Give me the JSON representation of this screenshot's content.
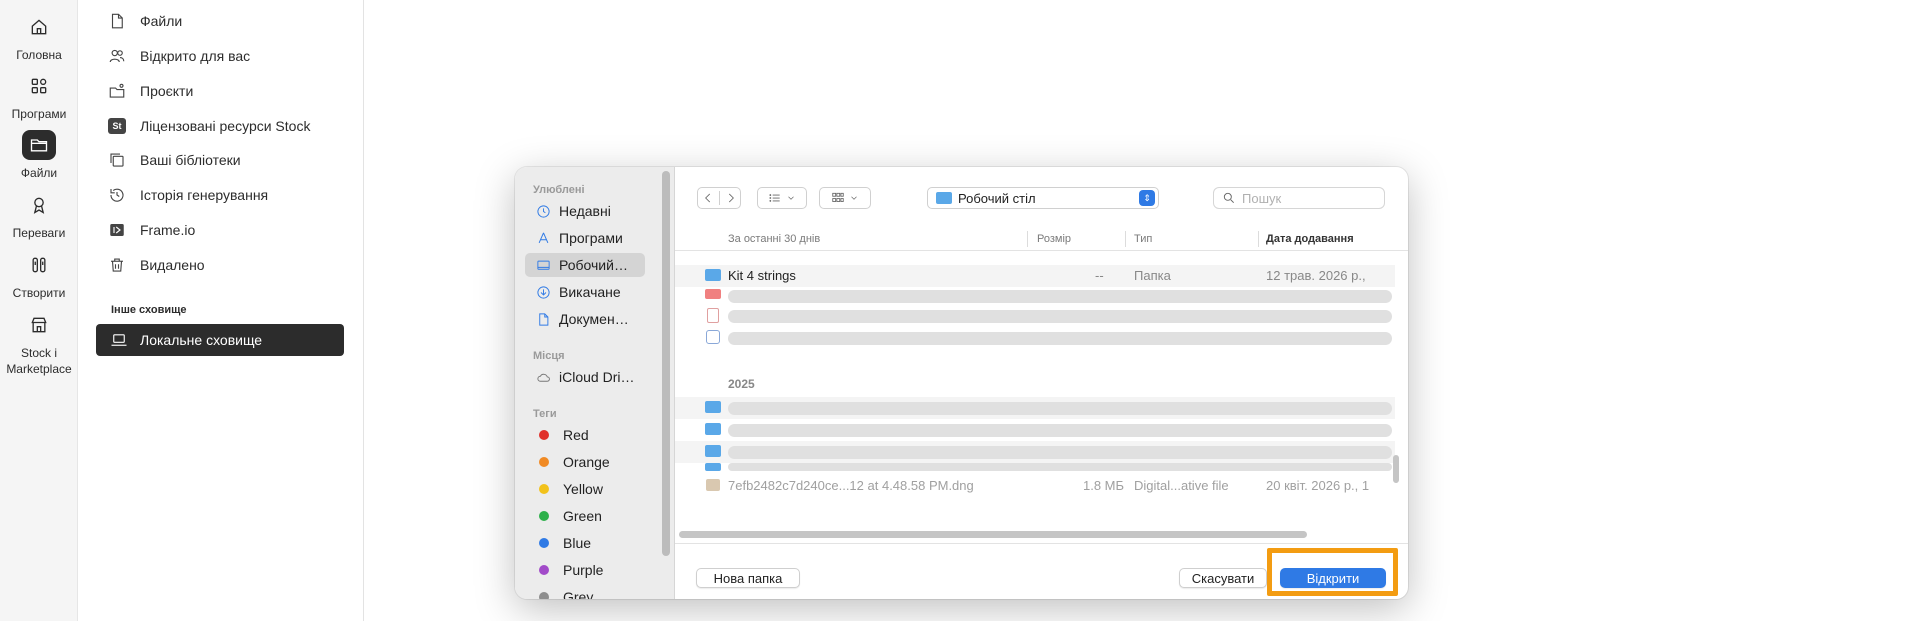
{
  "rail": [
    {
      "label": "Головна",
      "icon": "home-icon"
    },
    {
      "label": "Програми",
      "icon": "apps-icon"
    },
    {
      "label": "Файли",
      "icon": "folder-icon",
      "active": true
    },
    {
      "label": "Переваги",
      "icon": "award-icon"
    },
    {
      "label": "Створити",
      "icon": "create-icon"
    },
    {
      "label_line1": "Stock і",
      "label_line2": "Marketplace",
      "icon": "store-icon"
    }
  ],
  "sidebar": {
    "items": [
      {
        "label": "Файли",
        "icon": "file-icon"
      },
      {
        "label": "Відкрито для вас",
        "icon": "shared-icon"
      },
      {
        "label": "Проєкти",
        "icon": "projects-icon"
      },
      {
        "label": "Ліцензовані ресурси Stock",
        "icon": "stock-icon",
        "badge": "St"
      },
      {
        "label": "Ваші бібліотеки",
        "icon": "libraries-icon"
      },
      {
        "label": "Історія генерування",
        "icon": "history-icon"
      },
      {
        "label": "Frame.io",
        "icon": "frameio-icon"
      },
      {
        "label": "Видалено",
        "icon": "trash-icon"
      }
    ],
    "other_storage_heading": "Інше сховище",
    "local_storage": "Локальне сховище"
  },
  "dialog": {
    "sidebar": {
      "favorites_heading": "Улюблені",
      "favorites": [
        {
          "label": "Недавні",
          "icon": "clock-icon"
        },
        {
          "label": "Програми",
          "icon": "apps-icon"
        },
        {
          "label": "Робочий…",
          "icon": "desktop-icon",
          "selected": true
        },
        {
          "label": "Викачане",
          "icon": "download-icon"
        },
        {
          "label": "Докумен…",
          "icon": "document-icon"
        }
      ],
      "locations_heading": "Місця",
      "locations": [
        {
          "label": "iCloud Dri…",
          "icon": "cloud-icon"
        }
      ],
      "tags_heading": "Теги",
      "tags": [
        {
          "label": "Red",
          "color": "#e0302a"
        },
        {
          "label": "Orange",
          "color": "#f08a24"
        },
        {
          "label": "Yellow",
          "color": "#f2c21b"
        },
        {
          "label": "Green",
          "color": "#2db04a"
        },
        {
          "label": "Blue",
          "color": "#2f7ae5"
        },
        {
          "label": "Purple",
          "color": "#a24bc9"
        },
        {
          "label": "Grey",
          "color": "#8e8e8e"
        }
      ]
    },
    "toolbar": {
      "location": "Робочий стіл",
      "search_placeholder": "Пошук"
    },
    "columns": {
      "name": "За останні 30 днів",
      "size": "Розмір",
      "kind": "Тип",
      "date": "Дата додавання"
    },
    "rows_recent": [
      {
        "name": "Kit 4 strings",
        "size": "--",
        "kind": "Папка",
        "date": "12 трав. 2026 р.,"
      }
    ],
    "group_2025": "2025",
    "last_row": {
      "name": "7efb2482c7d240ce...12 at 4.48.58 PM.dng",
      "size": "1.8 МБ",
      "kind": "Digital...ative file",
      "date": "20 квіт. 2026 р., 1"
    },
    "footer": {
      "new_folder": "Нова папка",
      "cancel": "Скасувати",
      "open": "Відкрити"
    }
  },
  "colors": {
    "accent": "#2f7ae5",
    "highlight": "#f39c12",
    "active_bg": "#2c2c2c"
  }
}
